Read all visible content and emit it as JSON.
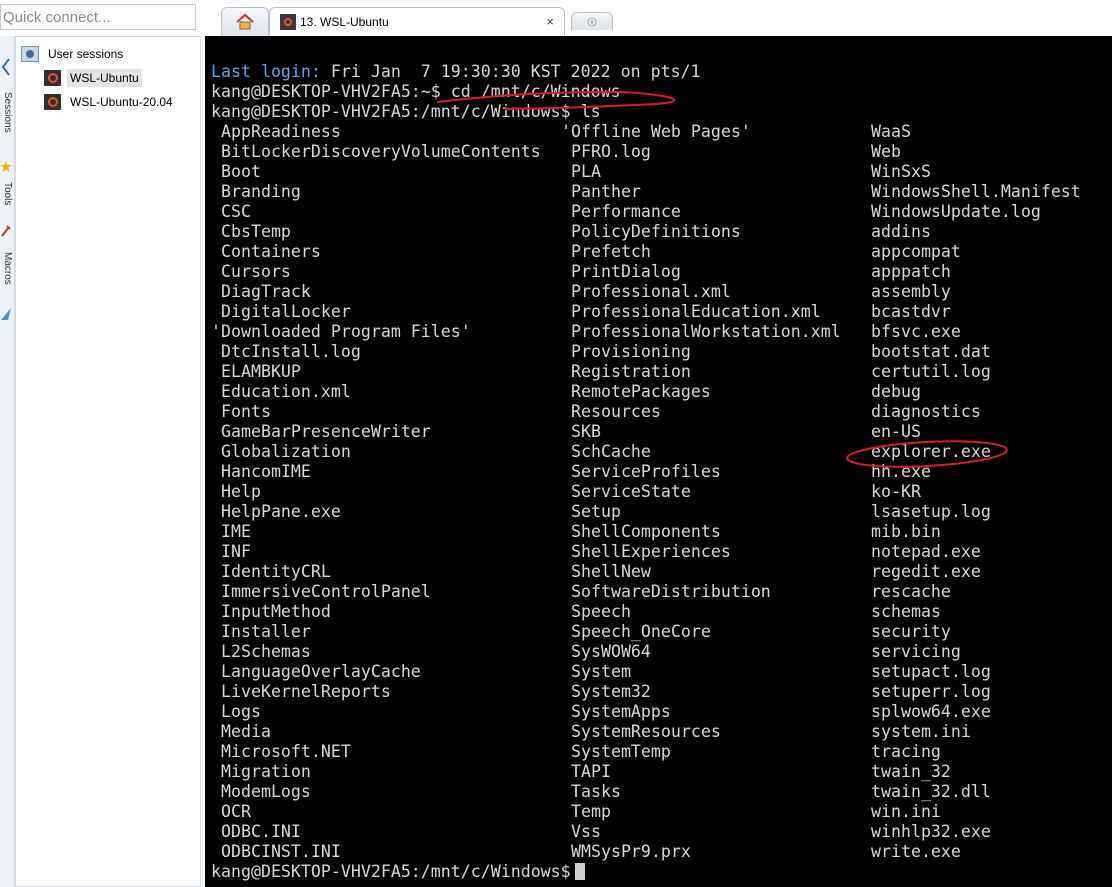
{
  "quick_connect": {
    "placeholder": "Quick connect..."
  },
  "side_tabs": [
    "Sessions",
    "Tools",
    "Macros"
  ],
  "sessions": {
    "root": "User sessions",
    "items": [
      "WSL-Ubuntu",
      "WSL-Ubuntu-20.04"
    ],
    "selected": "WSL-Ubuntu"
  },
  "tabs": {
    "active_title": "13. WSL-Ubuntu",
    "close_glyph": "×"
  },
  "terminal": {
    "last_login_label": "Last login:",
    "last_login_value": " Fri Jan  7 19:30:30 KST 2022 on pts/1",
    "prompt_home": "kang@DESKTOP-VHV2FA5:~$",
    "command_1": " cd /mnt/c/Windows",
    "prompt_windows": "kang@DESKTOP-VHV2FA5:/mnt/c/Windows$",
    "command_2": " ls",
    "final_prompt": "kang@DESKTOP-VHV2FA5:/mnt/c/Windows$",
    "ls_columns": [
      [
        " AppReadiness",
        " BitLockerDiscoveryVolumeContents",
        " Boot",
        " Branding",
        " CSC",
        " CbsTemp",
        " Containers",
        " Cursors",
        " DiagTrack",
        " DigitalLocker",
        "'Downloaded Program Files'",
        " DtcInstall.log",
        " ELAMBKUP",
        " Education.xml",
        " Fonts",
        " GameBarPresenceWriter",
        " Globalization",
        " HancomIME",
        " Help",
        " HelpPane.exe",
        " IME",
        " INF",
        " IdentityCRL",
        " ImmersiveControlPanel",
        " InputMethod",
        " Installer",
        " L2Schemas",
        " LanguageOverlayCache",
        " LiveKernelReports",
        " Logs",
        " Media",
        " Microsoft.NET",
        " Migration",
        " ModemLogs",
        " OCR",
        " ODBC.INI",
        " ODBCINST.INI"
      ],
      [
        "'Offline Web Pages'",
        " PFRO.log",
        " PLA",
        " Panther",
        " Performance",
        " PolicyDefinitions",
        " Prefetch",
        " PrintDialog",
        " Professional.xml",
        " ProfessionalEducation.xml",
        " ProfessionalWorkstation.xml",
        " Provisioning",
        " Registration",
        " RemotePackages",
        " Resources",
        " SKB",
        " SchCache",
        " ServiceProfiles",
        " ServiceState",
        " Setup",
        " ShellComponents",
        " ShellExperiences",
        " ShellNew",
        " SoftwareDistribution",
        " Speech",
        " Speech_OneCore",
        " SysWOW64",
        " System",
        " System32",
        " SystemApps",
        " SystemResources",
        " SystemTemp",
        " TAPI",
        " Tasks",
        " Temp",
        " Vss",
        " WMSysPr9.prx"
      ],
      [
        " WaaS",
        " Web",
        " WinSxS",
        " WindowsShell.Manifest",
        " WindowsUpdate.log",
        " addins",
        " appcompat",
        " apppatch",
        " assembly",
        " bcastdvr",
        " bfsvc.exe",
        " bootstat.dat",
        " certutil.log",
        " debug",
        " diagnostics",
        " en-US",
        " explorer.exe",
        " hh.exe",
        " ko-KR",
        " lsasetup.log",
        " mib.bin",
        " notepad.exe",
        " regedit.exe",
        " rescache",
        " schemas",
        " security",
        " servicing",
        " setupact.log",
        " setuperr.log",
        " splwow64.exe",
        " system.ini",
        " tracing",
        " twain_32",
        " twain_32.dll",
        " win.ini",
        " winhlp32.exe",
        " write.exe"
      ]
    ]
  },
  "colors": {
    "terminal_bg": "#000000",
    "terminal_fg": "#d8d8d8",
    "accent_blue": "#5aa5e6",
    "annotation_red": "#d81e1e"
  }
}
